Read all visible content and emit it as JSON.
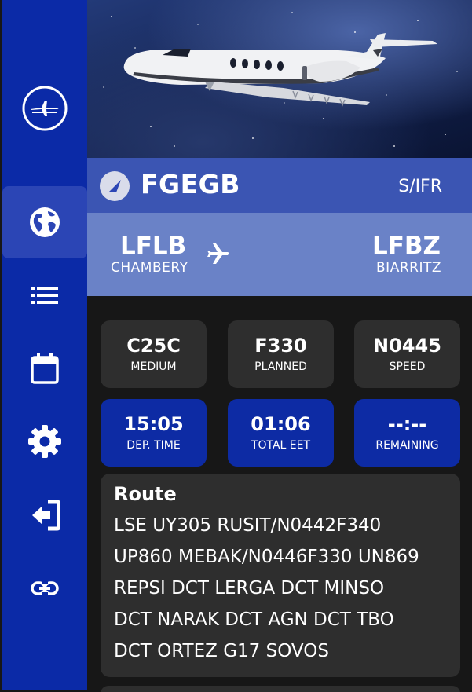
{
  "sidebar": {
    "items": [
      {
        "name": "map-icon",
        "active": false
      },
      {
        "name": "globe-icon",
        "active": true
      },
      {
        "name": "list-icon",
        "active": false
      },
      {
        "name": "calendar-icon",
        "active": false
      },
      {
        "name": "gear-icon",
        "active": false
      },
      {
        "name": "logout-icon",
        "active": false
      },
      {
        "name": "link-icon",
        "active": false
      }
    ]
  },
  "flight": {
    "callsign": "FGEGB",
    "rules": "S/IFR",
    "departure": {
      "code": "LFLB",
      "name": "CHAMBERY"
    },
    "arrival": {
      "code": "LFBZ",
      "name": "BIARRITZ"
    }
  },
  "stats": {
    "aircraft": {
      "value": "C25C",
      "label": "MEDIUM"
    },
    "level": {
      "value": "F330",
      "label": "PLANNED"
    },
    "speed": {
      "value": "N0445",
      "label": "SPEED"
    },
    "dep_time": {
      "value": "15:05",
      "label": "DEP. TIME"
    },
    "total_eet": {
      "value": "01:06",
      "label": "TOTAL EET"
    },
    "remaining": {
      "value": "--:--",
      "label": "REMAINING"
    }
  },
  "route": {
    "title": "Route",
    "text": "LSE UY305 RUSIT/N0442F340\nUP860 MEBAK/N0446F330 UN869\nREPSI DCT LERGA DCT MINSO\nDCT NARAK DCT AGN DCT TBO\nDCT ORTEZ G17 SOVOS"
  },
  "colors": {
    "sidebar": "#0b2aa7",
    "callsign_bar": "#3b55b3",
    "route_bar": "#6a82c7",
    "card_grey": "#2e2e2e",
    "card_blue": "#0d2ba4",
    "background": "#171717"
  }
}
